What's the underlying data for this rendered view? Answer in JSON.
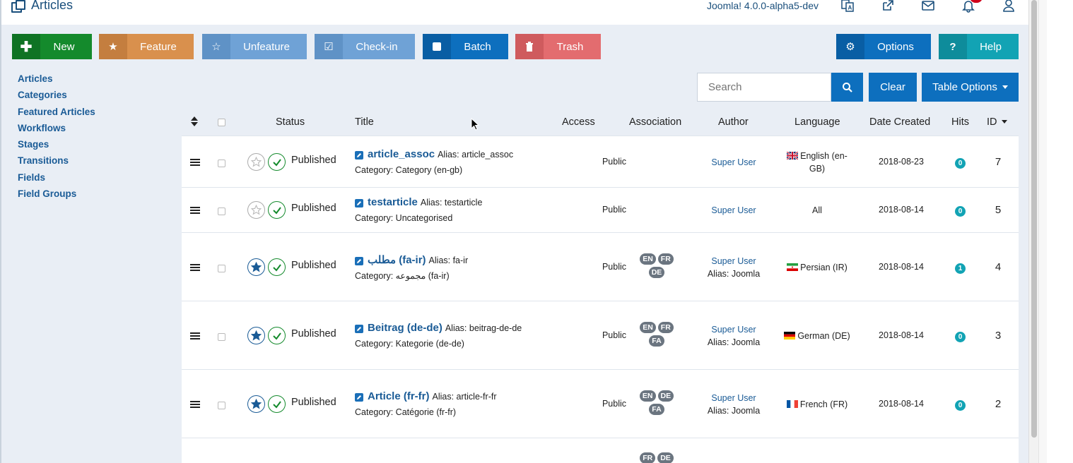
{
  "header": {
    "title": "Articles",
    "version": "Joomla! 4.0.0-alpha5-dev",
    "icons": [
      "language-icon",
      "external-link-icon",
      "mail-icon",
      "bell-icon",
      "user-icon"
    ]
  },
  "toolbar": {
    "new": "New",
    "feature": "Feature",
    "unfeature": "Unfeature",
    "checkin": "Check-in",
    "batch": "Batch",
    "trash": "Trash",
    "options": "Options",
    "help": "Help",
    "help_glyph": "?"
  },
  "sidebar": {
    "items": [
      {
        "label": "Articles"
      },
      {
        "label": "Categories"
      },
      {
        "label": "Featured Articles"
      },
      {
        "label": "Workflows"
      },
      {
        "label": "Stages"
      },
      {
        "label": "Transitions"
      },
      {
        "label": "Fields"
      },
      {
        "label": "Field Groups"
      }
    ]
  },
  "search": {
    "placeholder": "Search",
    "clear": "Clear",
    "table_options": "Table Options"
  },
  "table": {
    "columns": {
      "status": "Status",
      "title": "Title",
      "access": "Access",
      "association": "Association",
      "author": "Author",
      "language": "Language",
      "date_created": "Date Created",
      "hits": "Hits",
      "id": "ID"
    },
    "rows": [
      {
        "featured": false,
        "status": "Published",
        "title": "article_assoc",
        "alias": "Alias: article_assoc",
        "category": "Category: Category (en-gb)",
        "access": "Public",
        "assoc": [],
        "author": "Super User",
        "author_alias": "",
        "language": "English (en-GB)",
        "flag": "gb",
        "date": "2018-08-23",
        "hits": "0",
        "id": "7"
      },
      {
        "featured": false,
        "status": "Published",
        "title": "testarticle",
        "alias": "Alias: testarticle",
        "category": "Category: Uncategorised",
        "access": "Public",
        "assoc": [],
        "author": "Super User",
        "author_alias": "",
        "language": "All",
        "flag": "",
        "date": "2018-08-14",
        "hits": "0",
        "id": "5"
      },
      {
        "featured": true,
        "status": "Published",
        "title": "مطلب (fa-ir)",
        "alias": "Alias: fa-ir",
        "category": "Category: مجموعه (fa-ir)",
        "access": "Public",
        "assoc": [
          "EN",
          "FR",
          "DE"
        ],
        "author": "Super User",
        "author_alias": "Alias: Joomla",
        "language": "Persian (IR)",
        "flag": "ir",
        "date": "2018-08-14",
        "hits": "1",
        "id": "4"
      },
      {
        "featured": true,
        "status": "Published",
        "title": "Beitrag (de-de)",
        "alias": "Alias: beitrag-de-de",
        "category": "Category: Kategorie (de-de)",
        "access": "Public",
        "assoc": [
          "EN",
          "FR",
          "FA"
        ],
        "author": "Super User",
        "author_alias": "Alias: Joomla",
        "language": "German (DE)",
        "flag": "de",
        "date": "2018-08-14",
        "hits": "0",
        "id": "3"
      },
      {
        "featured": true,
        "status": "Published",
        "title": "Article (fr-fr)",
        "alias": "Alias: article-fr-fr",
        "category": "Category: Catégorie (fr-fr)",
        "access": "Public",
        "assoc": [
          "EN",
          "DE",
          "FA"
        ],
        "author": "Super User",
        "author_alias": "Alias: Joomla",
        "language": "French (FR)",
        "flag": "fr",
        "date": "2018-08-14",
        "hits": "0",
        "id": "2"
      },
      {
        "featured": true,
        "status": "",
        "title": "",
        "alias": "",
        "category": "",
        "access": "",
        "assoc": [
          "FR",
          "DE"
        ],
        "author": "",
        "author_alias": "",
        "language": "",
        "flag": "",
        "date": "",
        "hits": "",
        "id": ""
      }
    ]
  },
  "colors": {
    "primary": "#0d6fbe",
    "success": "#148a2c",
    "link": "#1a5b96"
  }
}
